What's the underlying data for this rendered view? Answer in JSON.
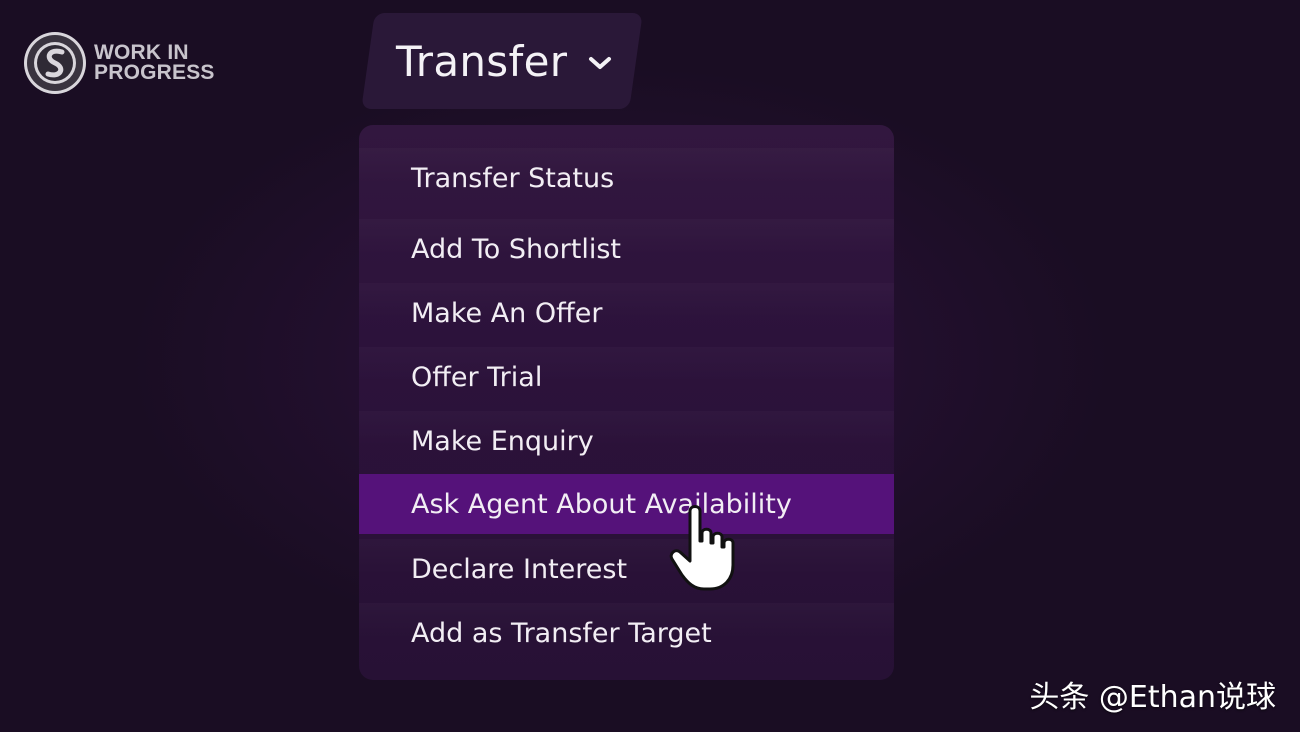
{
  "logo": {
    "line1": "WORK IN",
    "line2": "PROGRESS",
    "icon": "wip-seal-icon"
  },
  "header": {
    "menu_label": "Transfer",
    "chevron_icon": "chevron-down-icon"
  },
  "menu": {
    "selected_index": 5,
    "items": [
      {
        "label": "Transfer Status"
      },
      {
        "label": "Add To Shortlist"
      },
      {
        "label": "Make An Offer"
      },
      {
        "label": "Offer Trial"
      },
      {
        "label": "Make Enquiry"
      },
      {
        "label": "Ask Agent About Availability"
      },
      {
        "label": "Declare Interest"
      },
      {
        "label": "Add as Transfer Target"
      }
    ]
  },
  "cursor": {
    "icon": "hand-pointer-icon"
  },
  "watermark": {
    "text": "头条 @Ethan说球"
  },
  "colors": {
    "background": "#1a0d23",
    "menu_background": "#2c123b",
    "selected_item": "#55127a",
    "header_button": "#2a1838",
    "text": "#f2eef4"
  }
}
